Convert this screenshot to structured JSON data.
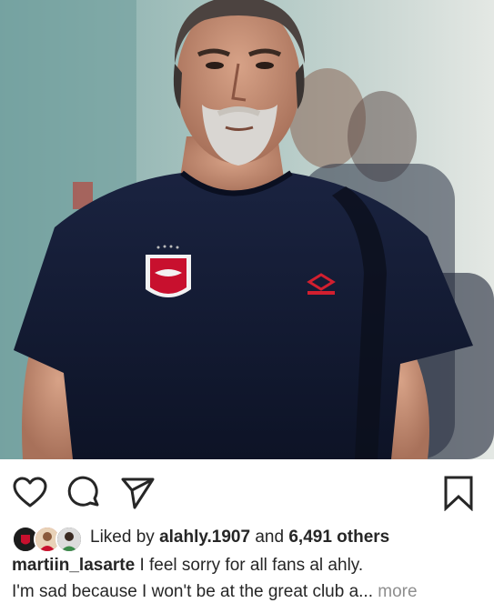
{
  "post": {
    "photo": {
      "alt_subject": "coach-portrait",
      "shirt_color": "#121a30",
      "background_color": "#8fb3b4",
      "crest_color": "#c8102e",
      "brand_logo_color": "#d21f2f"
    },
    "actions": {
      "like_icon": "heart-icon",
      "comment_icon": "comment-icon",
      "share_icon": "send-icon",
      "save_icon": "bookmark-icon"
    },
    "likes": {
      "prefix": "Liked by",
      "user": "alahly.1907",
      "connector": "and",
      "count_text": "6,491 others"
    },
    "caption": {
      "username": "martiin_lasarte",
      "text_line1": " I feel sorry for all fans al ahly.",
      "text_line2": "I'm sad because I won't be at the great club a",
      "ellipsis": "...",
      "more_label": " more"
    }
  }
}
